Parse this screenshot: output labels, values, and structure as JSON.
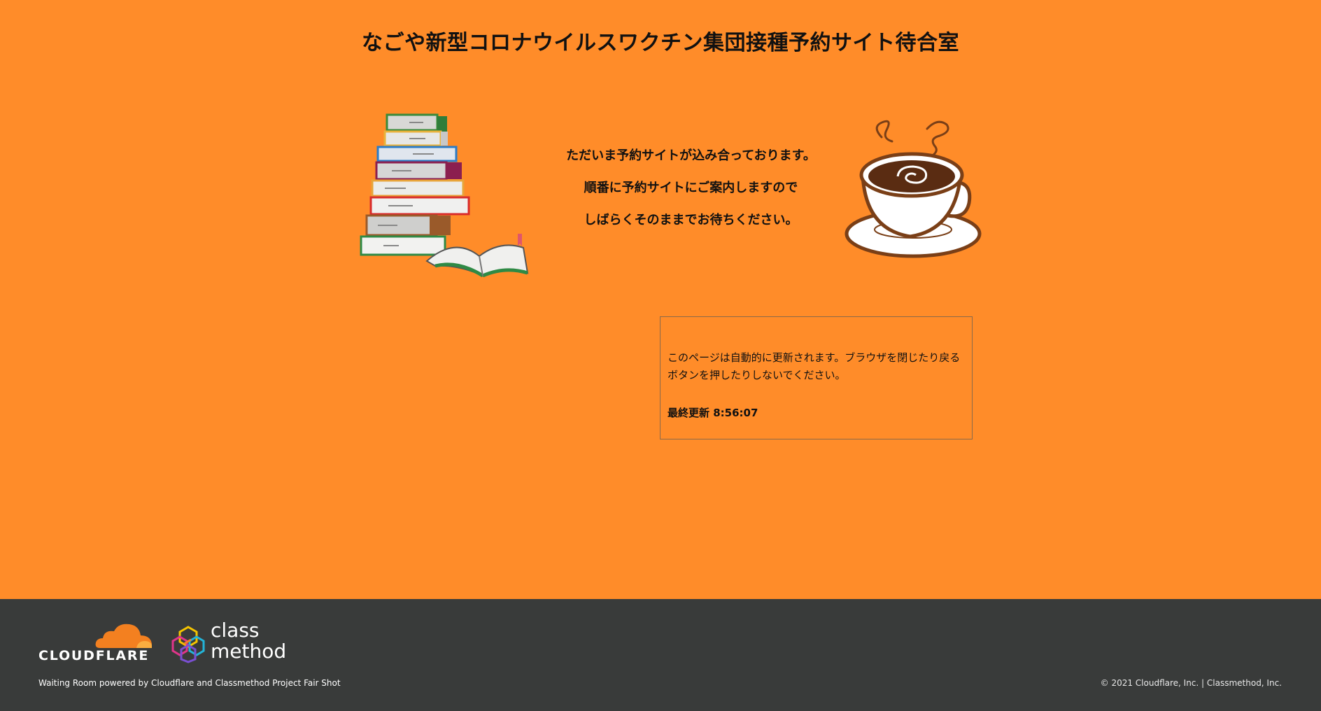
{
  "header": {
    "title": "なごや新型コロナウイルスワクチン集団接種予約サイト待合室"
  },
  "message": {
    "lines": [
      "ただいま予約サイトが込み合っております。",
      "順番に予約サイトにご案内しますので",
      "しばらくそのままでお待ちください。"
    ]
  },
  "notice": {
    "text": "このページは自動的に更新されます。ブラウザを閉じたり戻るボタンを押したりしないでください。",
    "last_updated": "最終更新 8:56:07"
  },
  "illustrations": {
    "left_icon": "book-stack-icon",
    "right_icon": "coffee-cup-icon"
  },
  "footer": {
    "cloudflare_wordmark": "CLOUDFLARE",
    "classmethod_wordmark": "class\nmethod",
    "powered_by": "Waiting Room powered by Cloudflare and Classmethod Project Fair Shot",
    "copyright": "© 2021 Cloudflare, Inc. | Classmethod, Inc."
  },
  "colors": {
    "background": "#ff8c29",
    "footer_background": "#393b3a",
    "cloudflare_orange": "#f38020",
    "text": "#111111"
  }
}
